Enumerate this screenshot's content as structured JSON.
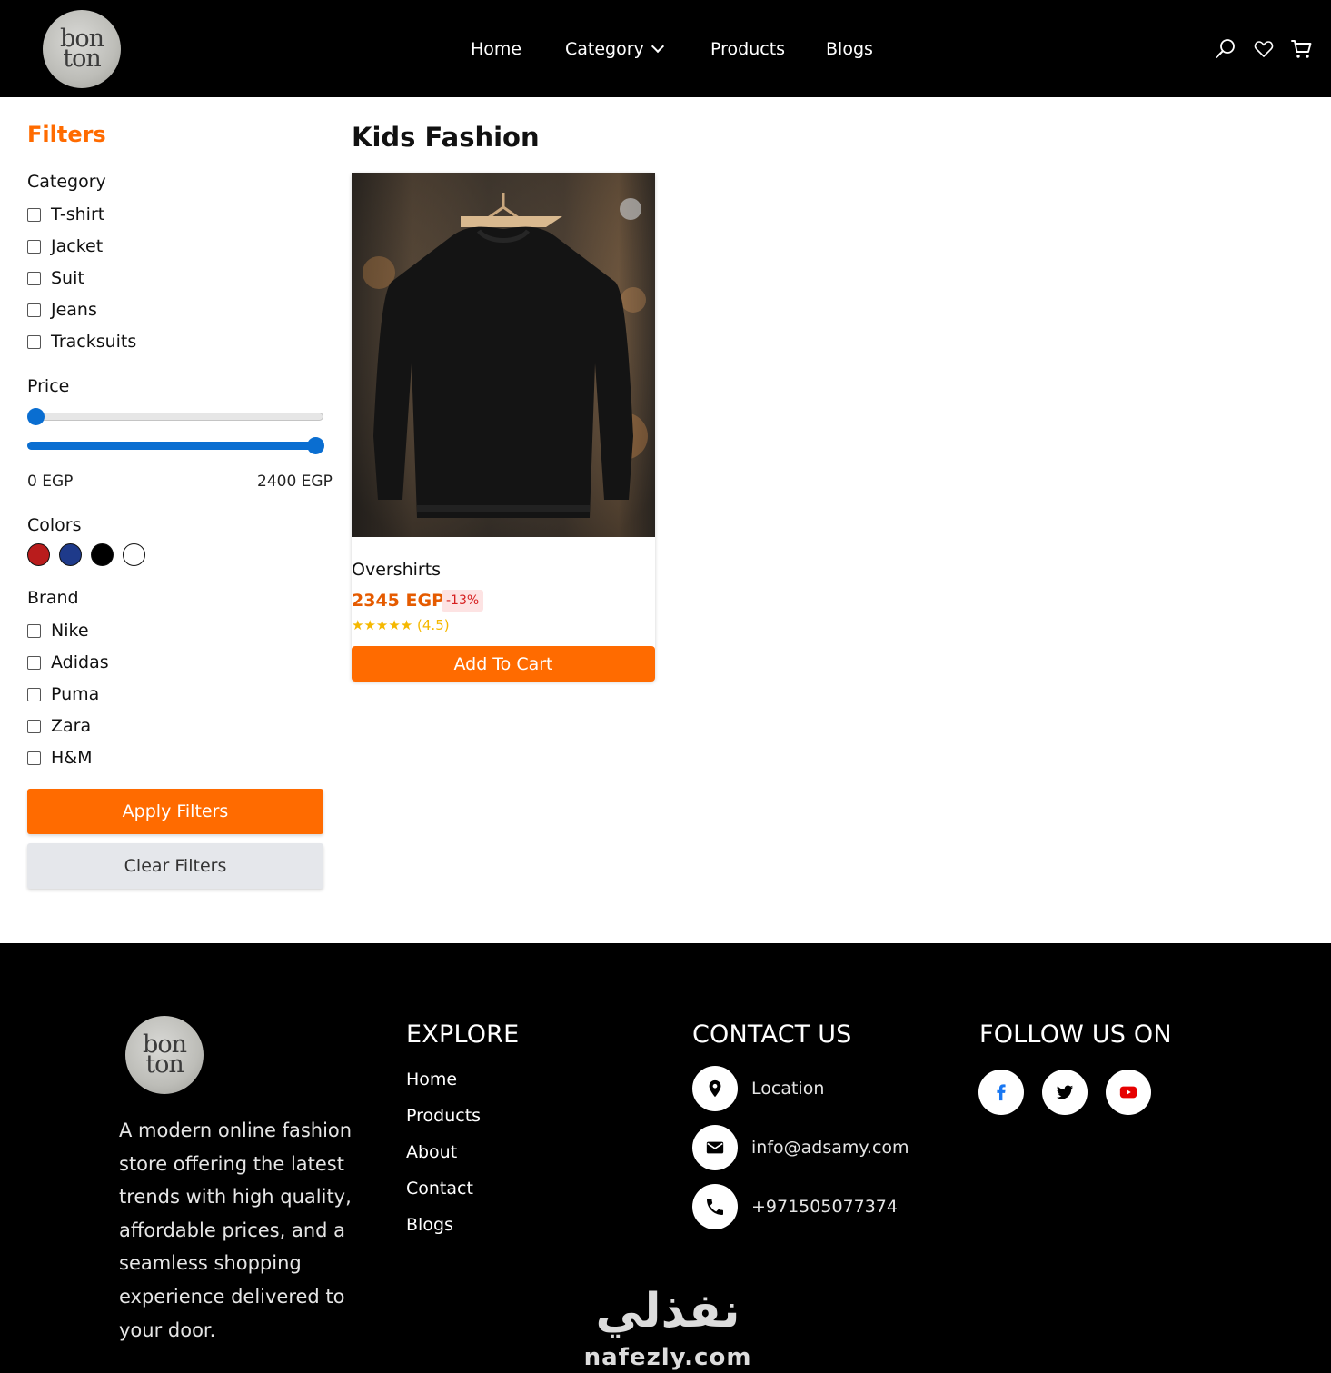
{
  "header": {
    "logo_top": "bon",
    "logo_bottom": "ton",
    "nav": [
      {
        "label": "Home"
      },
      {
        "label": "Category"
      },
      {
        "label": "Products"
      },
      {
        "label": "Blogs"
      }
    ],
    "icons": [
      "search-icon",
      "heart-icon",
      "cart-icon"
    ]
  },
  "filters": {
    "title": "Filters",
    "category": {
      "label": "Category",
      "items": [
        "T-shirt",
        "Jacket",
        "Suit",
        "Jeans",
        "Tracksuits"
      ]
    },
    "price": {
      "label": "Price",
      "min_label": "0 EGP",
      "max_label": "2400 EGP",
      "min_value_fraction": 0.0,
      "max_value_fraction": 1.0
    },
    "colors": {
      "label": "Colors",
      "swatches": [
        "#b91c1c",
        "#1e3a8a",
        "#000000",
        "#ffffff"
      ]
    },
    "brand": {
      "label": "Brand",
      "items": [
        "Nike",
        "Adidas",
        "Puma",
        "Zara",
        "H&M"
      ]
    },
    "apply_label": "Apply Filters",
    "clear_label": "Clear Filters"
  },
  "main": {
    "title": "Kids Fashion",
    "product": {
      "name": "Overshirts",
      "price": "2345 EGP",
      "discount": "-13%",
      "stars": "★★★★★",
      "rating": "(4.5)",
      "add_label": "Add To Cart"
    }
  },
  "footer": {
    "logo_top": "bon",
    "logo_bottom": "ton",
    "description": "A modern online fashion store offering the latest trends with high quality, affordable prices, and a seamless shopping experience delivered to your door.",
    "explore": {
      "title": "EXPLORE",
      "links": [
        "Home",
        "Products",
        "About",
        "Contact",
        "Blogs"
      ]
    },
    "contact": {
      "title": "CONTACT US",
      "location": "Location",
      "email": "info@adsamy.com",
      "phone": "+971505077374"
    },
    "follow": {
      "title": "FOLLOW US ON",
      "icons": [
        "facebook-icon",
        "twitter-icon",
        "youtube-icon"
      ]
    },
    "watermark_ar": "نفذلي",
    "watermark_en": "nafezly.com"
  },
  "colors": {
    "accent": "#ff6b00",
    "slider": "#0a6ed1",
    "header_bg": "#000000"
  }
}
